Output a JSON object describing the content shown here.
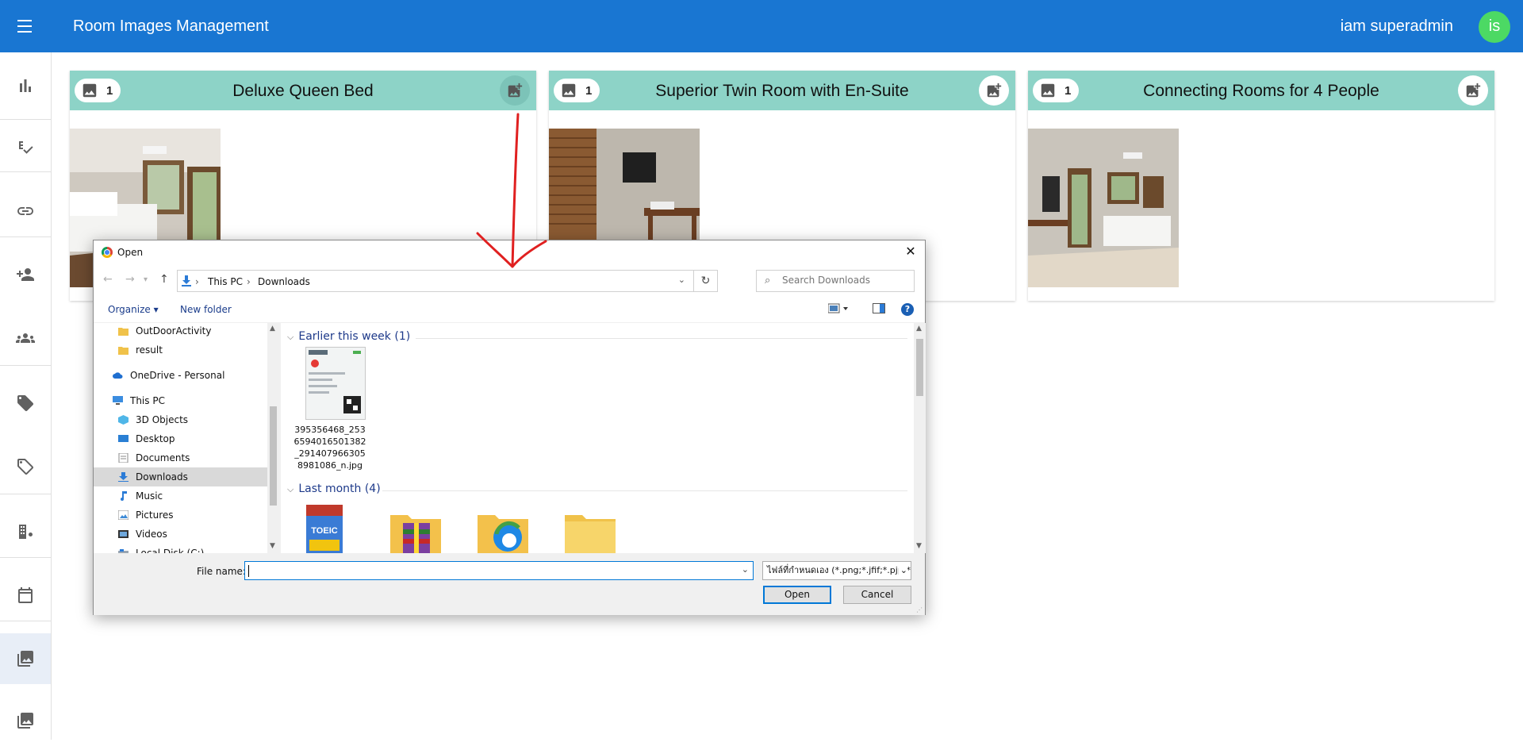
{
  "app": {
    "title": "Room Images Management",
    "user_name": "iam superadmin",
    "avatar_initials": "is",
    "brand_color": "#1976d2",
    "avatar_color": "#4cd964"
  },
  "sidebar": {
    "items": [
      {
        "icon": "bar-chart-icon"
      },
      {
        "icon": "spellcheck-icon"
      },
      {
        "icon": "link-icon"
      },
      {
        "icon": "person-add-icon"
      },
      {
        "icon": "group-icon"
      },
      {
        "icon": "tag-filled-icon"
      },
      {
        "icon": "tag-outline-icon"
      },
      {
        "icon": "building-settings-icon"
      },
      {
        "icon": "calendar-icon"
      },
      {
        "icon": "photo-library-icon",
        "active": true
      },
      {
        "icon": "photo-library-icon"
      }
    ]
  },
  "cards": [
    {
      "title": "Deluxe Queen Bed",
      "image_count": "1"
    },
    {
      "title": "Superior Twin Room with En-Suite",
      "image_count": "1"
    },
    {
      "title": "Connecting Rooms for 4 People",
      "image_count": "1"
    }
  ],
  "card_header_color": "#8dd3c7",
  "dialog": {
    "title": "Open",
    "breadcrumb": [
      "This PC",
      "Downloads"
    ],
    "search_placeholder": "Search Downloads",
    "organize_label": "Organize ▾",
    "new_folder_label": "New folder",
    "help_label": "?",
    "nav_items": [
      {
        "label": "OutDoorActivity",
        "icon": "folder-icon"
      },
      {
        "label": "result",
        "icon": "folder-icon"
      },
      {
        "label": "OneDrive - Personal",
        "icon": "cloud-icon"
      },
      {
        "label": "This PC",
        "icon": "computer-icon"
      },
      {
        "label": "3D Objects",
        "icon": "cube-icon"
      },
      {
        "label": "Desktop",
        "icon": "desktop-icon"
      },
      {
        "label": "Documents",
        "icon": "document-icon"
      },
      {
        "label": "Downloads",
        "icon": "download-icon",
        "selected": true
      },
      {
        "label": "Music",
        "icon": "music-icon"
      },
      {
        "label": "Pictures",
        "icon": "picture-icon"
      },
      {
        "label": "Videos",
        "icon": "video-icon"
      },
      {
        "label": "Local Disk (C:)",
        "icon": "disk-icon"
      }
    ],
    "groups": [
      {
        "label": "Earlier this week (1)",
        "files": [
          {
            "name": "395356468_2536594016501382_2914079663058981086_n.jpg",
            "icon": "image-file-thumbnail"
          }
        ]
      },
      {
        "label": "Last month (4)",
        "files": [
          {
            "name": "",
            "icon": "toeic-book-thumbnail"
          },
          {
            "name": "",
            "icon": "winrar-icon"
          },
          {
            "name": "",
            "icon": "edge-folder-icon"
          },
          {
            "name": "",
            "icon": "folder-icon"
          }
        ]
      }
    ],
    "file_name_label": "File name:",
    "file_name_value": "",
    "file_type": "ไฟล์ที่กำหนดเอง (*.png;*.jfif;*.pjp;*.jpg;*.jpeg)",
    "open_label": "Open",
    "cancel_label": "Cancel"
  },
  "annotation_arrow_color": "#e02020"
}
